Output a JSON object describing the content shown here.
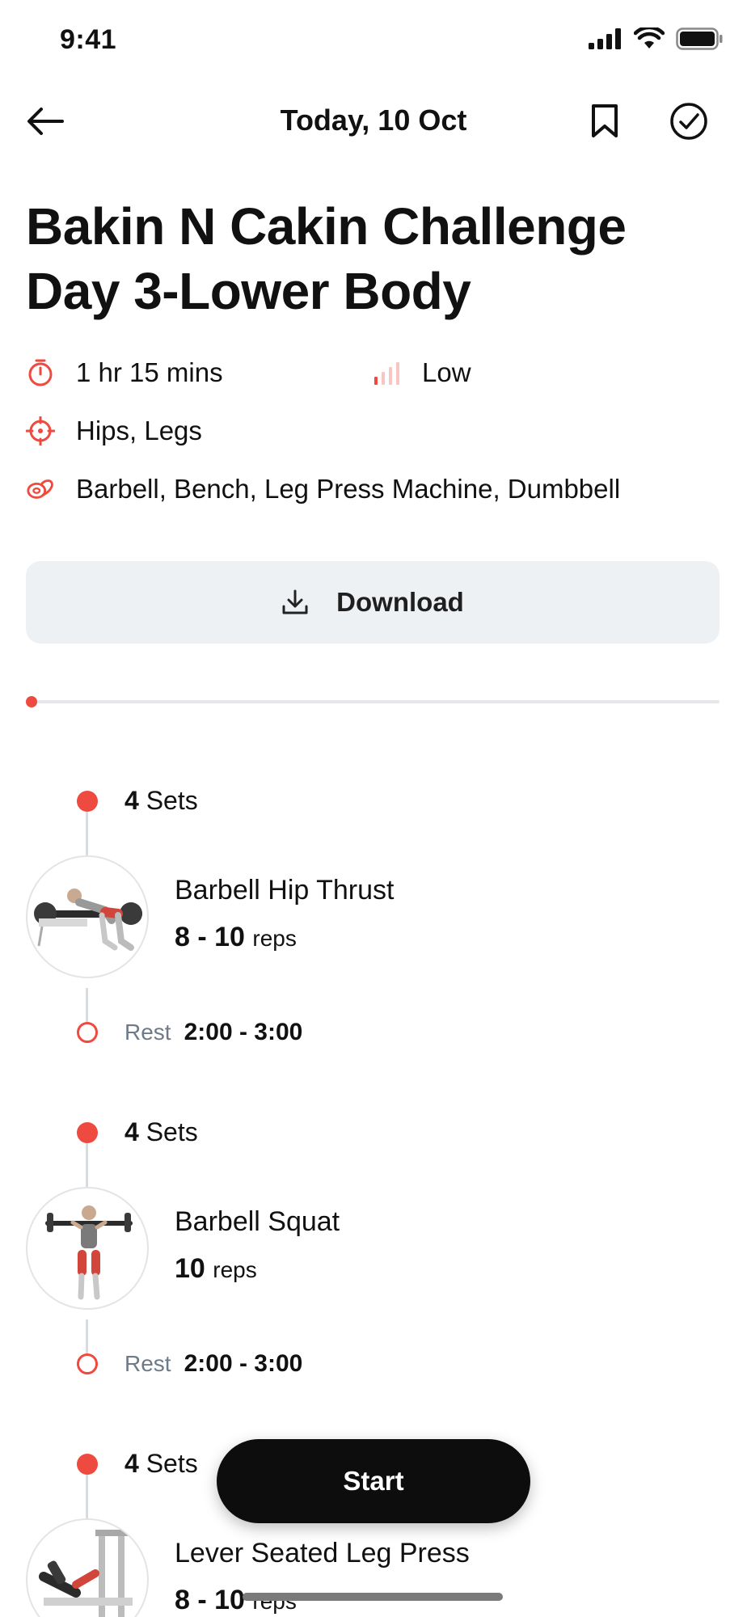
{
  "status_bar": {
    "time": "9:41"
  },
  "header": {
    "title": "Today, 10 Oct"
  },
  "workout": {
    "title_line1": "Bakin N Cakin Challenge",
    "title_line2": "Day 3-Lower Body",
    "duration": "1 hr 15 mins",
    "level": "Low",
    "target": "Hips, Legs",
    "equipment": "Barbell, Bench, Leg Press Machine, Dumbbell"
  },
  "download": {
    "label": "Download"
  },
  "progress": {
    "fraction": 0.0
  },
  "exercises": [
    {
      "sets_count": "4",
      "sets_word": "Sets",
      "name": "Barbell Hip Thrust",
      "reps_value": "8 - 10",
      "reps_unit": "reps",
      "rest_label": "Rest",
      "rest_value": "2:00 - 3:00"
    },
    {
      "sets_count": "4",
      "sets_word": "Sets",
      "name": "Barbell Squat",
      "reps_value": "10",
      "reps_unit": "reps",
      "rest_label": "Rest",
      "rest_value": "2:00 - 3:00"
    },
    {
      "sets_count": "4",
      "sets_word": "Sets",
      "name": "Lever Seated Leg Press",
      "reps_value": "8 - 10",
      "reps_unit": "reps"
    }
  ],
  "start": {
    "label": "Start"
  },
  "colors": {
    "accent": "#ef4a3f",
    "button_dark": "#0d0d0d",
    "download_bg": "#eef1f4",
    "rest_label": "#6f7a89"
  },
  "icons": {
    "back": "arrow-left-icon",
    "bookmark": "bookmark-icon",
    "done": "check-circle-icon",
    "duration": "stopwatch-icon",
    "level": "signal-bars-icon",
    "target": "crosshair-icon",
    "equipment": "equipment-icon",
    "download": "download-icon"
  }
}
